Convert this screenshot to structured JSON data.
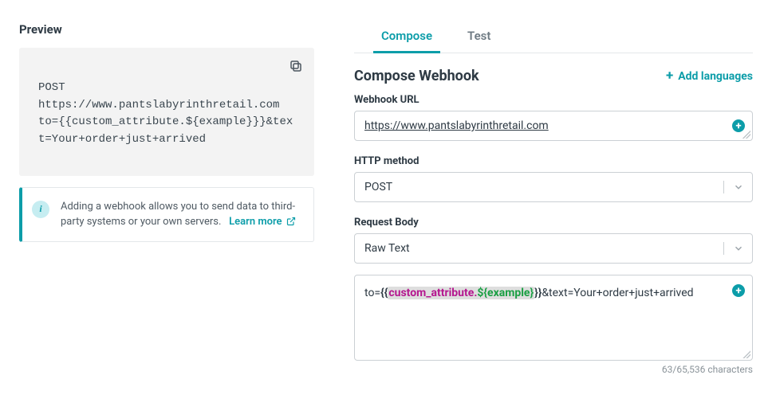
{
  "preview": {
    "title": "Preview",
    "content": "POST\nhttps://www.pantslabyrinthretail.com\nto={{custom_attribute.${example}}}&text=Your+order+just+arrived"
  },
  "info_callout": {
    "text": "Adding a webhook allows you to send data to third-party systems or your own servers.",
    "link_label": "Learn more"
  },
  "tabs": {
    "compose": "Compose",
    "test": "Test",
    "active": "compose"
  },
  "compose": {
    "heading": "Compose Webhook",
    "add_languages_label": "Add languages",
    "url_label": "Webhook URL",
    "url_value": "https://www.pantslabyrinthretail.com",
    "method_label": "HTTP method",
    "method_value": "POST",
    "body_label": "Request Body",
    "body_type_value": "Raw Text",
    "body_tokens": {
      "prefix": "to=",
      "brace_open": "{{",
      "attr": "custom_attribute",
      "dot": ".",
      "placeholder": "${example}",
      "brace_close": "}}",
      "suffix": "&text=Your+order+just+arrived"
    },
    "char_count": "63/65,536 characters"
  }
}
